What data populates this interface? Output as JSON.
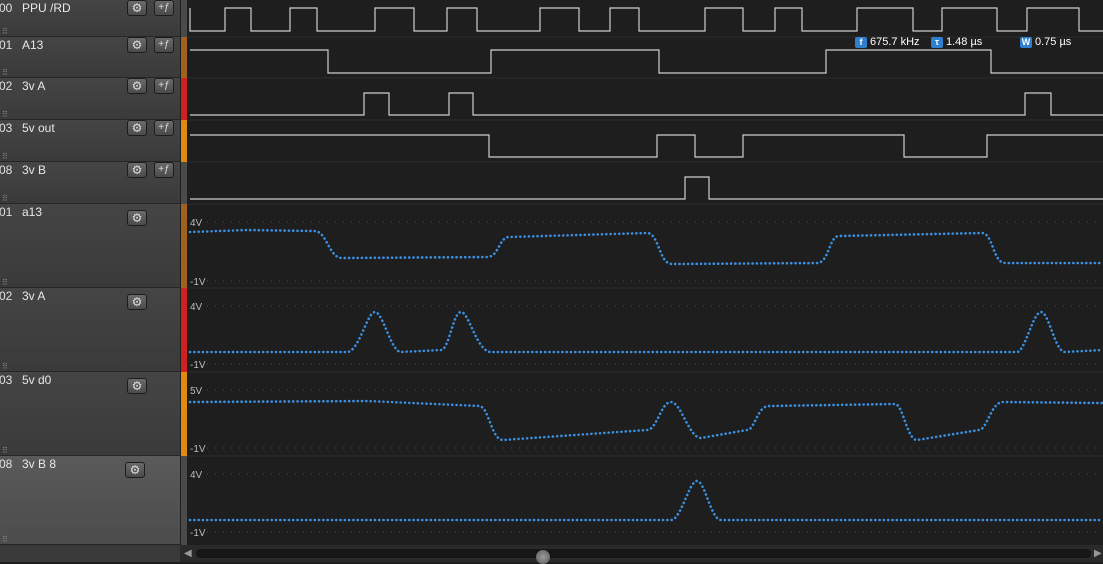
{
  "channels": [
    {
      "number": "00",
      "name": "PPU /RD",
      "kind": "digital",
      "color": "#4a4a4a"
    },
    {
      "number": "01",
      "name": "A13",
      "kind": "digital",
      "color": "#a0601e"
    },
    {
      "number": "02",
      "name": "3v A",
      "kind": "digital",
      "color": "#d02020"
    },
    {
      "number": "03",
      "name": "5v out",
      "kind": "digital",
      "color": "#e08a10"
    },
    {
      "number": "08",
      "name": "3v B",
      "kind": "digital",
      "color": "#4a4a4a"
    },
    {
      "number": "01",
      "name": "a13",
      "kind": "analog",
      "color": "#a0601e",
      "vmax_label": "4V",
      "vmin_label": "-1V"
    },
    {
      "number": "02",
      "name": "3v A",
      "kind": "analog",
      "color": "#d02020",
      "vmax_label": "4V",
      "vmin_label": "-1V"
    },
    {
      "number": "03",
      "name": "5v d0",
      "kind": "analog",
      "color": "#e08a10",
      "vmax_label": "5V",
      "vmin_label": "-1V"
    },
    {
      "number": "08",
      "name": "3v B 8",
      "kind": "analog",
      "color": "#4a4a4a",
      "vmax_label": "4V",
      "vmin_label": "-1V"
    }
  ],
  "measurements": {
    "frequency_badge": "f",
    "frequency": "675.7 kHz",
    "period_badge": "τ",
    "period": "1.48 µs",
    "width_badge": "W",
    "width": "0.75 µs"
  },
  "icons": {
    "settings": "gear-icon",
    "trigger": "trigger-icon"
  },
  "colors": {
    "trace": "#3b8fe0",
    "digital_line": "#cfcfcf",
    "background": "#1e1e1e"
  }
}
